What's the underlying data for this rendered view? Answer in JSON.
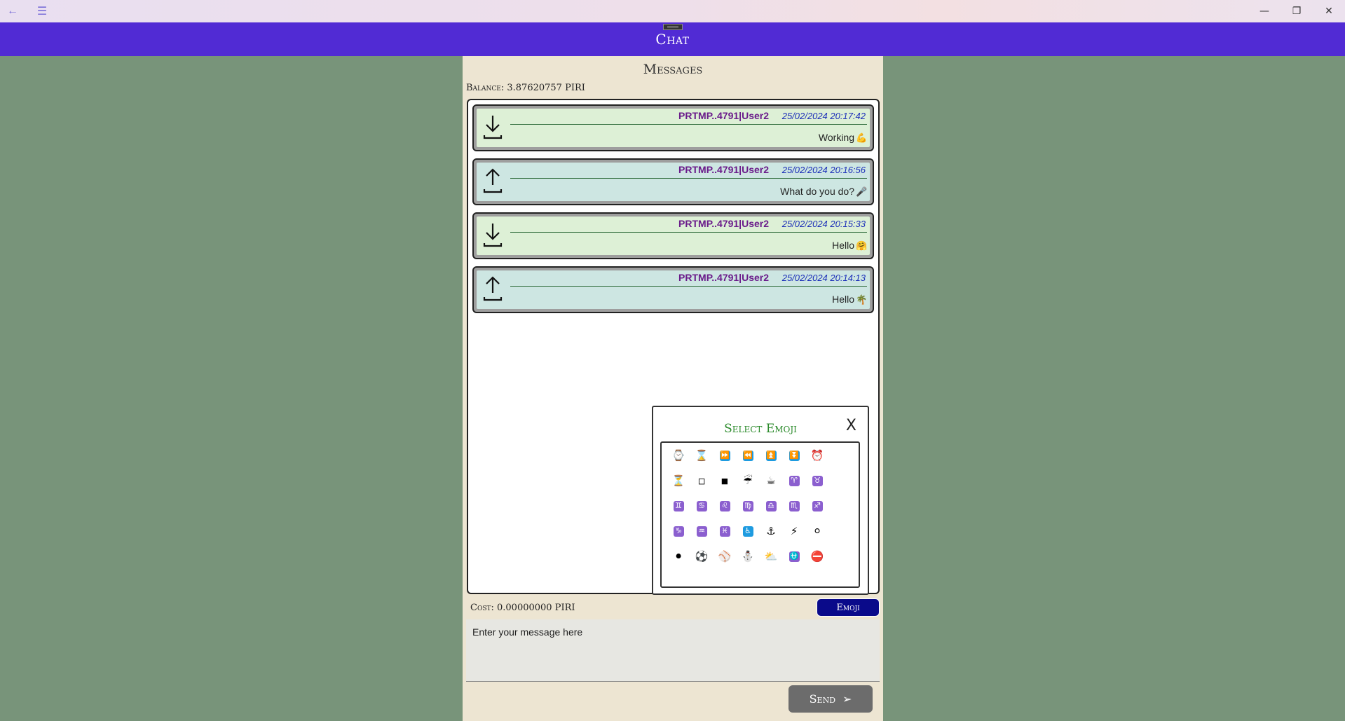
{
  "window": {
    "back_icon": "←",
    "menu_icon": "☰",
    "minimize_icon": "—",
    "restore_icon": "❐",
    "close_icon": "✕"
  },
  "appbar": {
    "title": "Chat"
  },
  "main": {
    "heading": "Messages",
    "balance": "Balance: 3.87620757 PIRI"
  },
  "messages": [
    {
      "direction": "in",
      "sender": "PRTMP..4791|User2",
      "date": "25/02/2024 20:17:42",
      "text": "Working",
      "emoji": "💪"
    },
    {
      "direction": "out",
      "sender": "PRTMP..4791|User2",
      "date": "25/02/2024 20:16:56",
      "text": "What do you do?",
      "emoji": "🎤"
    },
    {
      "direction": "in",
      "sender": "PRTMP..4791|User2",
      "date": "25/02/2024 20:15:33",
      "text": "Hello",
      "emoji": "🤗"
    },
    {
      "direction": "out",
      "sender": "PRTMP..4791|User2",
      "date": "25/02/2024 20:14:13",
      "text": "Hello",
      "emoji": "🌴"
    }
  ],
  "picker": {
    "title": "Select Emoji",
    "close": "X",
    "emojis": [
      [
        "⌚",
        "⌛",
        "⏩",
        "⏪",
        "⏫",
        "⏬",
        "⏰"
      ],
      [
        "⏳",
        "◽",
        "◾",
        "☔",
        "☕",
        "♈",
        "♉"
      ],
      [
        "♊",
        "♋",
        "♌",
        "♍",
        "♎",
        "♏",
        "♐"
      ],
      [
        "♑",
        "♒",
        "♓",
        "♿",
        "⚓",
        "⚡",
        "⚪"
      ],
      [
        "⚫",
        "⚽",
        "⚾",
        "⛄",
        "⛅",
        "⛎",
        "⛔"
      ]
    ]
  },
  "footer": {
    "cost": "Cost: 0.00000000 PIRI",
    "emoji_button": "Emoji",
    "input_text": "Enter your message here",
    "send_label": "Send",
    "send_icon": "➢"
  }
}
